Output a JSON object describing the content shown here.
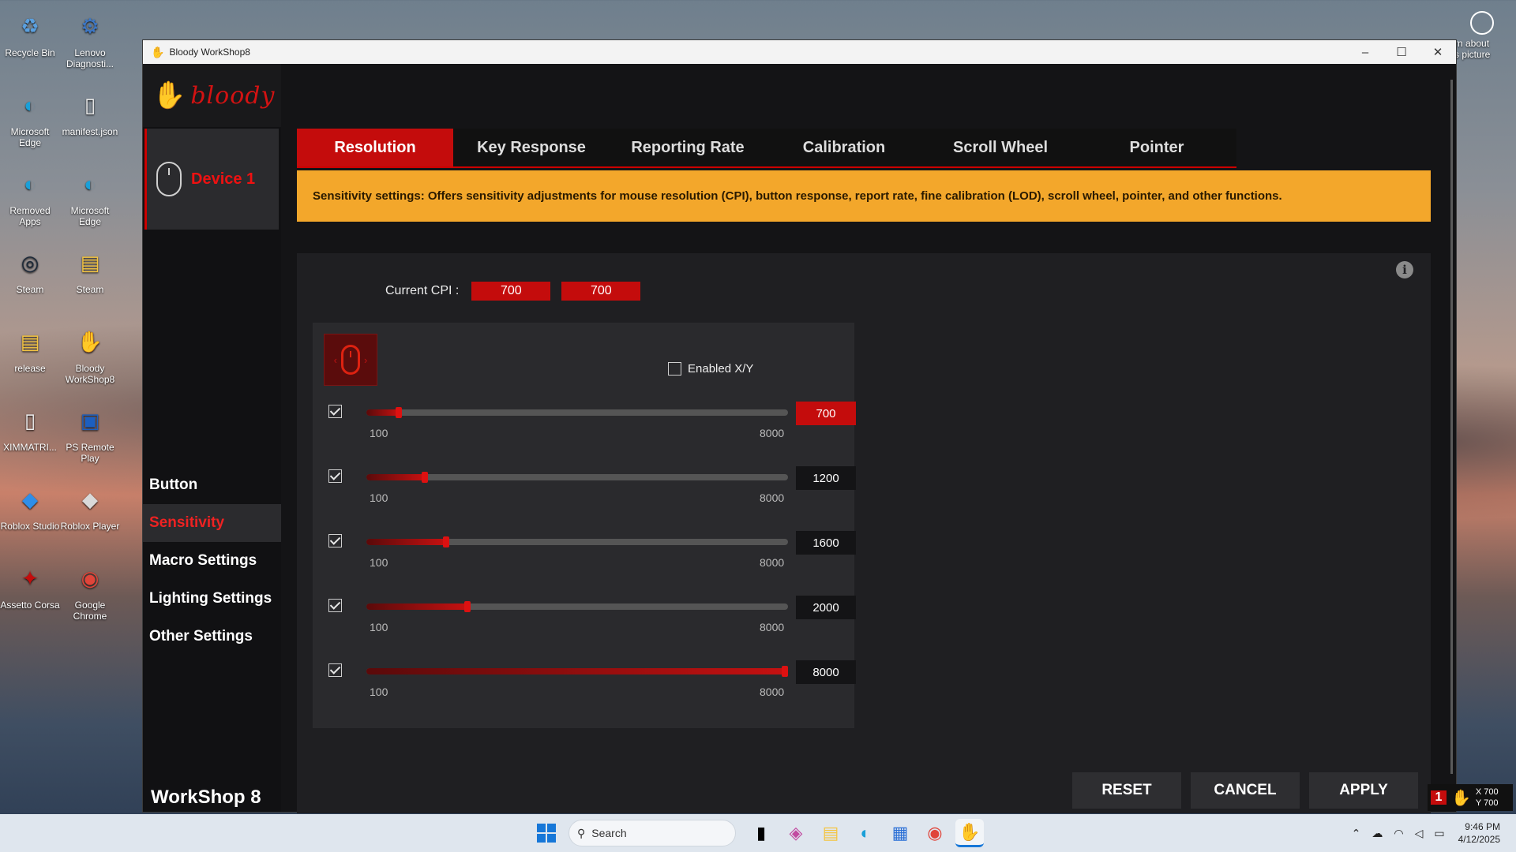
{
  "desktop": {
    "icons": [
      {
        "label": "Recycle Bin",
        "glyph": "♻",
        "color": "#5aa0e0"
      },
      {
        "label": "Lenovo Diagnosti...",
        "glyph": "⚙",
        "color": "#3c78c8"
      },
      {
        "label": "Microsoft Edge",
        "glyph": "◐",
        "color": "#1aa0d8"
      },
      {
        "label": "manifest.json",
        "glyph": "▯",
        "color": "#eeeeee"
      },
      {
        "label": "Removed Apps",
        "glyph": "◐",
        "color": "#1aa0d8"
      },
      {
        "label": "Microsoft Edge",
        "glyph": "◐",
        "color": "#1aa0d8"
      },
      {
        "label": "Steam",
        "glyph": "◎",
        "color": "#1b2838"
      },
      {
        "label": "Steam",
        "glyph": "▤",
        "color": "#f4c542"
      },
      {
        "label": "release",
        "glyph": "▤",
        "color": "#f4c542"
      },
      {
        "label": "Bloody WorkShop8",
        "glyph": "✋",
        "color": "#c40c0c"
      },
      {
        "label": "XIMMATRI...",
        "glyph": "▯",
        "color": "#eeeeee"
      },
      {
        "label": "PS Remote Play",
        "glyph": "▣",
        "color": "#1d5fbf"
      },
      {
        "label": "Roblox Studio",
        "glyph": "◆",
        "color": "#2f8ee8"
      },
      {
        "label": "Roblox Player",
        "glyph": "◆",
        "color": "#d9d9d9"
      },
      {
        "label": "Assetto Corsa",
        "glyph": "✦",
        "color": "#c40c0c"
      },
      {
        "label": "Google Chrome",
        "glyph": "◉",
        "color": "#e0453a"
      }
    ],
    "learn_about": "rn about\ns picture"
  },
  "window": {
    "title": "Bloody WorkShop8",
    "controls": {
      "minimize": "–",
      "maximize": "☐",
      "close": "✕"
    }
  },
  "sidebar": {
    "logo_text": "bloody",
    "device_label": "Device 1",
    "nav": [
      {
        "label": "Button",
        "active": false
      },
      {
        "label": "Sensitivity",
        "active": true
      },
      {
        "label": "Macro Settings",
        "active": false
      },
      {
        "label": "Lighting Settings",
        "active": false
      },
      {
        "label": "Other Settings",
        "active": false
      }
    ],
    "footer": "WorkShop 8"
  },
  "tabs": [
    {
      "label": "Resolution",
      "active": true
    },
    {
      "label": "Key Response",
      "active": false
    },
    {
      "label": "Reporting Rate",
      "active": false
    },
    {
      "label": "Calibration",
      "active": false
    },
    {
      "label": "Scroll Wheel",
      "active": false
    },
    {
      "label": "Pointer",
      "active": false
    }
  ],
  "banner": "Sensitivity settings: Offers sensitivity adjustments for mouse resolution (CPI), button response, report rate, fine calibration (LOD), scroll wheel, pointer, and other functions.",
  "cpi": {
    "label": "Current CPI :",
    "x": "700",
    "y": "700"
  },
  "enable_xy": {
    "label": "Enabled X/Y",
    "checked": false
  },
  "levels": [
    {
      "value": 700,
      "display": "700",
      "min": "100",
      "max": "8000",
      "checked": true,
      "active": true
    },
    {
      "value": 1200,
      "display": "1200",
      "min": "100",
      "max": "8000",
      "checked": true,
      "active": false
    },
    {
      "value": 1600,
      "display": "1600",
      "min": "100",
      "max": "8000",
      "checked": true,
      "active": false
    },
    {
      "value": 2000,
      "display": "2000",
      "min": "100",
      "max": "8000",
      "checked": true,
      "active": false
    },
    {
      "value": 8000,
      "display": "8000",
      "min": "100",
      "max": "8000",
      "checked": true,
      "active": false
    }
  ],
  "actions": {
    "reset": "RESET",
    "cancel": "CANCEL",
    "apply": "APPLY"
  },
  "overlay": {
    "badge": "1",
    "x": "X 700",
    "y": "Y 700"
  },
  "taskbar": {
    "search_placeholder": "Search",
    "time": "9:46 PM",
    "date": "4/12/2025"
  },
  "colors": {
    "accent": "#c40c0c",
    "banner": "#f3a72b"
  }
}
